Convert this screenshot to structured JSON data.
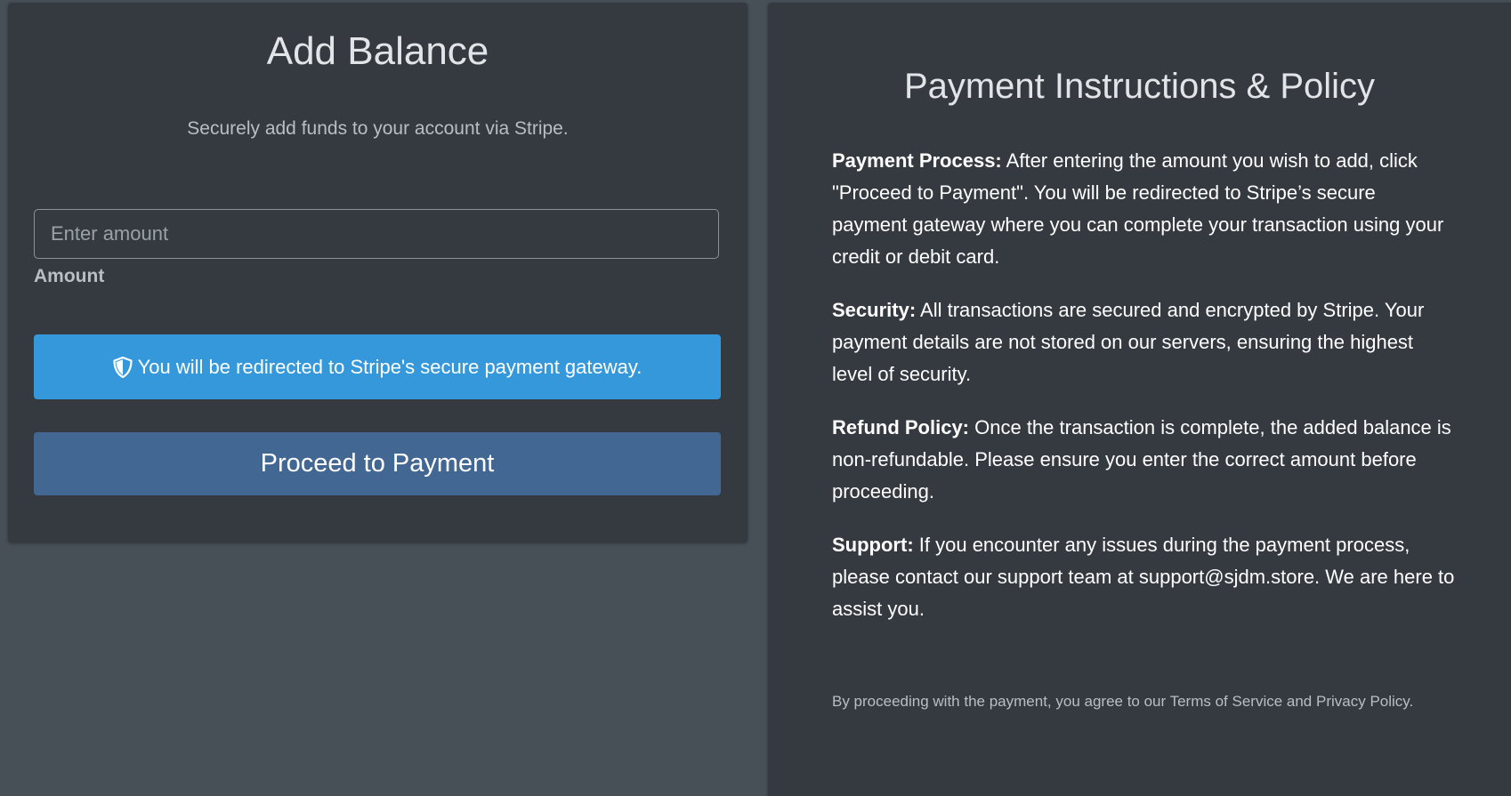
{
  "add_balance": {
    "title": "Add Balance",
    "subtitle": "Securely add funds to your account via Stripe.",
    "amount_placeholder": "Enter amount",
    "amount_label": "Amount",
    "redirect_notice": "You will be redirected to Stripe's secure payment gateway.",
    "proceed_label": "Proceed to Payment",
    "notice_icon": "shield-icon"
  },
  "policy": {
    "title": "Payment Instructions & Policy",
    "sections": [
      {
        "heading": "Payment Process:",
        "text": " After entering the amount you wish to add, click \"Proceed to Payment\". You will be redirected to Stripe’s secure payment gateway where you can complete your transaction using your credit or debit card."
      },
      {
        "heading": "Security:",
        "text": " All transactions are secured and encrypted by Stripe. Your payment details are not stored on our servers, ensuring the highest level of security."
      },
      {
        "heading": "Refund Policy:",
        "text": " Once the transaction is complete, the added balance is non-refundable. Please ensure you enter the correct amount before proceeding."
      },
      {
        "heading": "Support:",
        "text": " If you encounter any issues during the payment process, please contact our support team at support@sjdm.store. We are here to assist you."
      }
    ],
    "footer": "By proceeding with the payment, you agree to our Terms of Service and Privacy Policy."
  },
  "colors": {
    "page_background": "#474f57",
    "card_background": "#343a40",
    "info_banner": "#3498db",
    "proceed_button": "#426792"
  }
}
